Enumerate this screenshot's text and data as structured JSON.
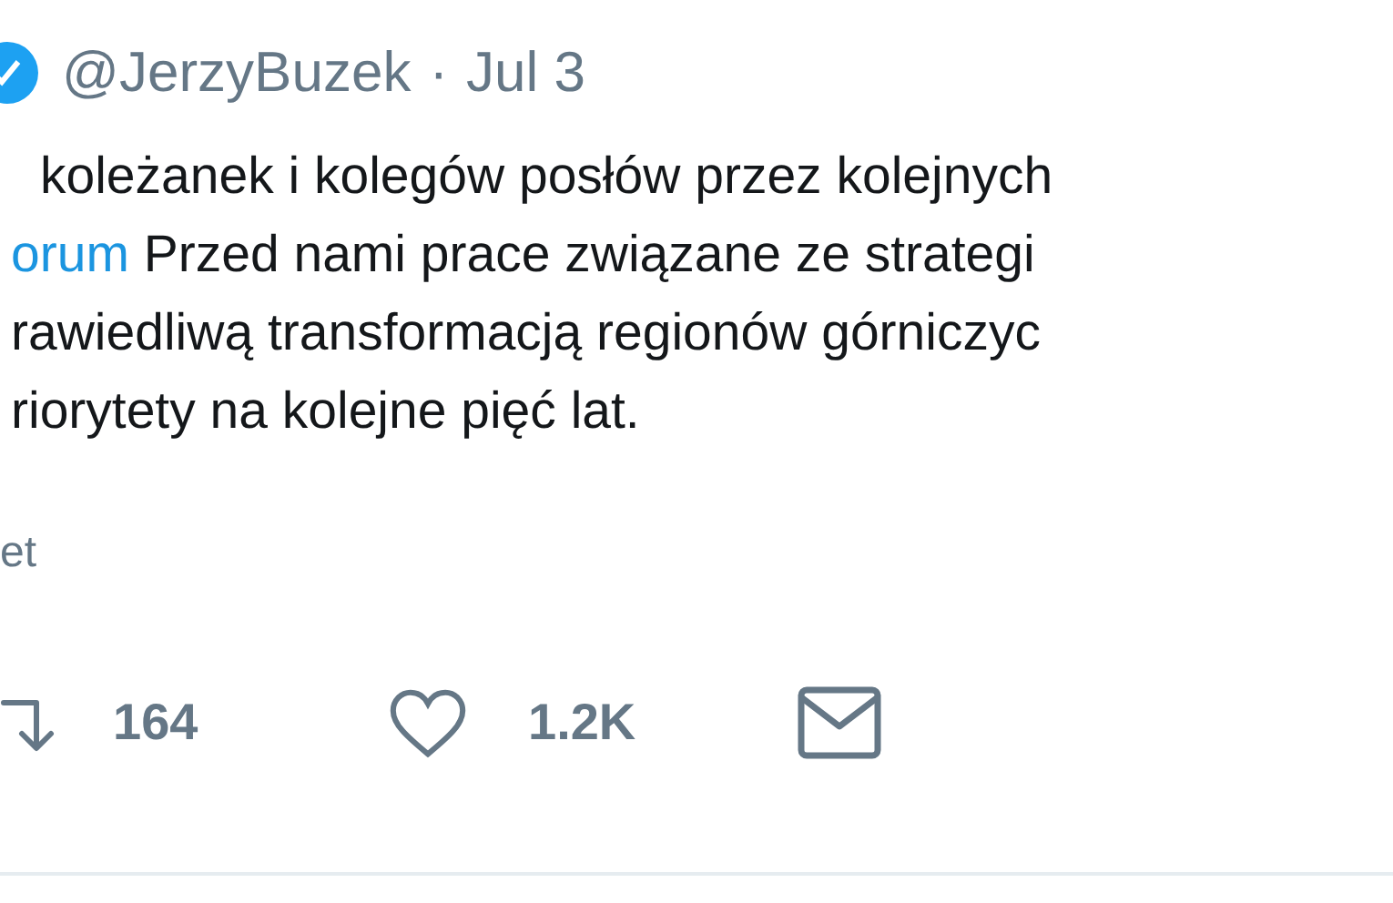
{
  "header": {
    "handle": "@JerzyBuzek",
    "separator": "·",
    "date": "Jul 3"
  },
  "body": [
    [
      {
        "kind": "text",
        "text": "koleżanek i kolegów posłów przez kolejnych"
      }
    ],
    [
      {
        "kind": "link",
        "text": "orum"
      },
      {
        "kind": "text",
        "text": " Przed nami prace związane ze strategi"
      }
    ],
    [
      {
        "kind": "text",
        "text": "rawiedliwą transformacją regionów górniczyc"
      }
    ],
    [
      {
        "kind": "text",
        "text": "riorytety na kolejne pięć lat."
      }
    ]
  ],
  "translate": "et",
  "actions": [
    {
      "kind": "retweet",
      "count": "164"
    },
    {
      "kind": "like",
      "count": "1.2K"
    },
    {
      "kind": "message"
    }
  ]
}
